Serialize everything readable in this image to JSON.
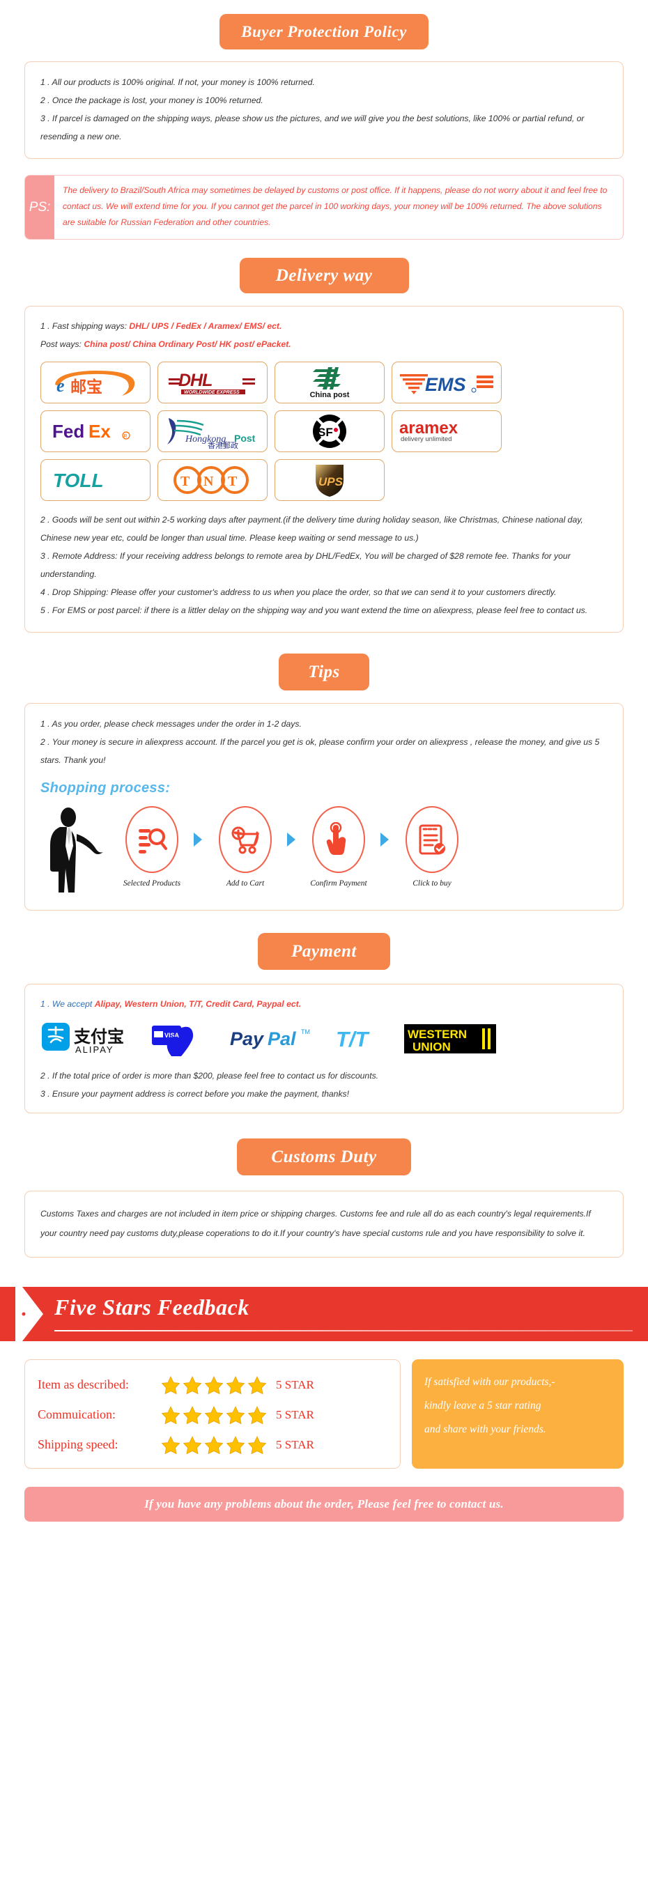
{
  "sections": {
    "buyer_protection": {
      "heading": "Buyer Protection Policy",
      "items": [
        "1 . All our products is 100% original. If not, your money is 100% returned.",
        "2 . Once the package is lost, your money is 100% returned.",
        "3 . If parcel is damaged on the shipping ways, please show us the pictures, and we will give you the best solutions, like 100% or partial refund, or resending a new one."
      ]
    },
    "ps": {
      "tag": "PS:",
      "text": "The delivery to Brazil/South Africa may sometimes be delayed by customs or post office. If it happens, please do not worry about it and feel free to contact us. We will extend time for you. If you cannot get the parcel in 100 working days, your money will be 100% returned. The above solutions are suitable for Russian Federation and other countries."
    },
    "delivery": {
      "heading": "Delivery way",
      "fast_label": "1 . Fast shipping ways:",
      "fast_value": "DHL/ UPS / FedEx / Aramex/ EMS/ ect.",
      "post_label": "Post ways:",
      "post_value": "China post/ China Ordinary Post/ HK post/ ePacket.",
      "carriers": [
        {
          "name": "ePacket / e邮宝",
          "icon": "epacket-logo",
          "caption": ""
        },
        {
          "name": "DHL",
          "icon": "dhl-logo",
          "caption": ""
        },
        {
          "name": "China post",
          "icon": "china-post-logo",
          "caption": "China post"
        },
        {
          "name": "EMS",
          "icon": "ems-logo",
          "caption": ""
        },
        {
          "name": "FedEx",
          "icon": "fedex-logo",
          "caption": ""
        },
        {
          "name": "Hongkong Post",
          "icon": "hongkong-post-logo",
          "caption": ""
        },
        {
          "name": "SF Express",
          "icon": "sf-express-logo",
          "caption": ""
        },
        {
          "name": "Aramex",
          "icon": "aramex-logo",
          "caption": ""
        },
        {
          "name": "TOLL",
          "icon": "toll-logo",
          "caption": ""
        },
        {
          "name": "TNT",
          "icon": "tnt-logo",
          "caption": ""
        },
        {
          "name": "UPS",
          "icon": "ups-logo",
          "caption": ""
        }
      ],
      "items": [
        "2 . Goods will be sent out within 2-5 working days after payment.(if the delivery time during holiday season, like Christmas, Chinese national day, Chinese new year etc, could be longer than usual time. Please keep waiting or send message to us.)",
        "3 . Remote Address: If your receiving address belongs to remote area by DHL/FedEx, You will be charged of $28 remote fee. Thanks for your understanding.",
        "4 . Drop Shipping: Please offer your customer's address to us when you place the order, so that we can send it to your customers directly.",
        "5 . For EMS or post parcel: if there is a littler delay on the shipping way and you want extend the time on aliexpress, please feel free to contact us."
      ]
    },
    "tips": {
      "heading": "Tips",
      "items": [
        "1 .  As you order, please check messages under the order in 1-2 days.",
        "2 . Your money is secure in aliexpress account. If the parcel you get is ok, please confirm your order on aliexpress , release the money, and give us 5 stars. Thank you!"
      ],
      "process_title": "Shopping process:",
      "steps": [
        {
          "label": "Selected Products",
          "icon": "search-list-icon"
        },
        {
          "label": "Add to Cart",
          "icon": "cart-plus-icon"
        },
        {
          "label": "Confirm Payment",
          "icon": "hand-click-icon"
        },
        {
          "label": "Click to buy",
          "icon": "checklist-icon"
        }
      ]
    },
    "payment": {
      "heading": "Payment",
      "accept_label": "1 . We accept",
      "accept_value": "Alipay, Western Union, T/T, Credit Card, Paypal ect.",
      "methods": [
        {
          "name": "Alipay",
          "icon": "alipay-logo"
        },
        {
          "name": "Visa Credit Card",
          "icon": "visa-card-hand-logo"
        },
        {
          "name": "PayPal",
          "icon": "paypal-logo"
        },
        {
          "name": "T/T",
          "icon": "tt-logo"
        },
        {
          "name": "Western Union",
          "icon": "western-union-logo"
        }
      ],
      "items": [
        "2 . If the total price of order is more than $200, please feel free to contact us for discounts.",
        "3 . Ensure your payment address is correct before you make the payment, thanks!"
      ]
    },
    "customs": {
      "heading": "Customs Duty",
      "text": "Customs Taxes and charges are not included in item price or shipping charges. Customs fee and rule all do as each country's legal requirements.If your country need pay customs duty,please coperations to do it.If your country's have special customs rule and you have responsibility to solve it."
    },
    "feedback": {
      "banner_title": "Five Stars Feedback",
      "ratings": [
        {
          "label": "Item as described:",
          "stars": 5,
          "value": "5 STAR"
        },
        {
          "label": "Commuication:",
          "stars": 5,
          "value": "5 STAR"
        },
        {
          "label": "Shipping speed:",
          "stars": 5,
          "value": "5 STAR"
        }
      ],
      "thanks_lines": [
        "If satisfied with our products,-",
        "kindly leave a 5 star rating",
        "and share with your friends."
      ],
      "contact_bar": "If you have any problems about the order, Please feel free to contact us."
    }
  },
  "colors": {
    "pill_orange": "#F5854A",
    "card_border": "#F6CFB5",
    "accent_red": "#F4463C",
    "banner_red": "#E8372C",
    "thanks_orange": "#FBB040",
    "contact_pink": "#F99A9A",
    "process_blue": "#56B7EC"
  }
}
